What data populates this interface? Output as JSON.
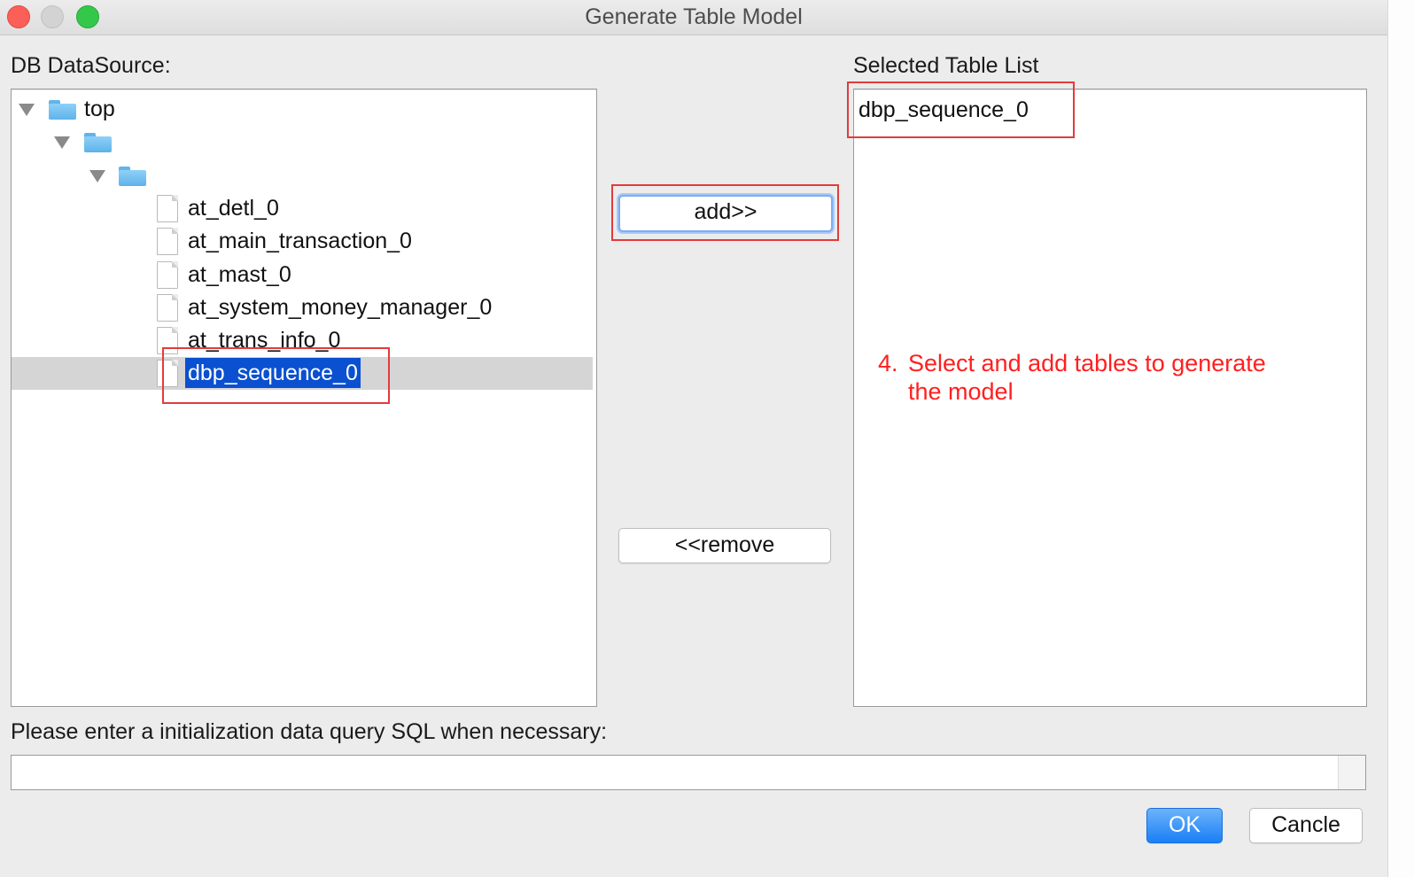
{
  "window": {
    "title": "Generate Table Model"
  },
  "left": {
    "label": "DB DataSource:",
    "tree": {
      "root_label": "top",
      "level1_label": "",
      "level2_label": "",
      "tables": [
        "at_detl_0",
        "at_main_transaction_0",
        "at_mast_0",
        "at_system_money_manager_0",
        "at_trans_info_0",
        "dbp_sequence_0"
      ],
      "selected_table": "dbp_sequence_0"
    }
  },
  "buttons": {
    "add": "add>>",
    "remove": "<<remove",
    "ok": "OK",
    "cancel": "Cancle"
  },
  "right": {
    "label": "Selected Table List",
    "items": [
      "dbp_sequence_0"
    ]
  },
  "annotation": {
    "number": "4.",
    "line1": "Select and add tables to generate",
    "line2": "the model"
  },
  "sql": {
    "label": "Please enter a initialization data query SQL when necessary:",
    "value": ""
  },
  "colors": {
    "selection": "#0a50d0",
    "highlight_box": "#e23b3b",
    "annotation": "#ff1f1f",
    "ok_button": "#1a7ff5"
  }
}
